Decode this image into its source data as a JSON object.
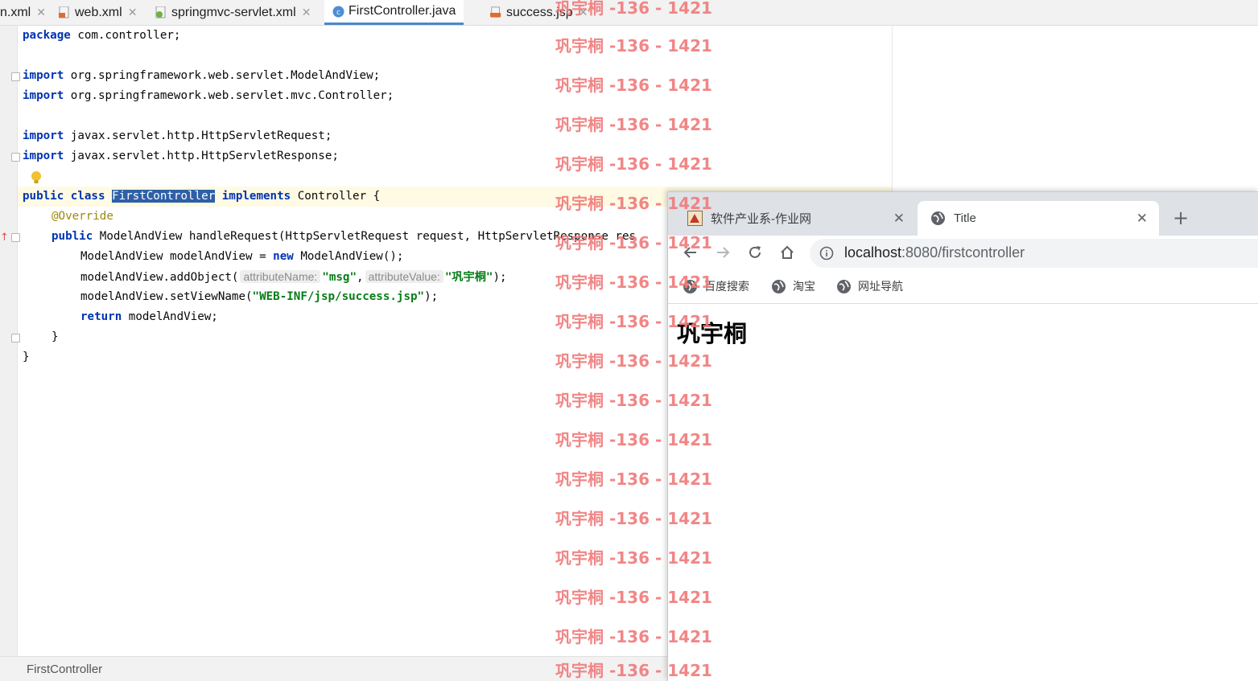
{
  "editor": {
    "tabs": [
      {
        "label": "n.xml",
        "icon": "none"
      },
      {
        "label": "web.xml",
        "icon": "xml-file-icon"
      },
      {
        "label": "springmvc-servlet.xml",
        "icon": "spring-xml-file-icon"
      },
      {
        "label": "FirstController.java",
        "icon": "java-class-icon",
        "active": true
      },
      {
        "label": "success.jsp",
        "icon": "jsp-file-icon"
      }
    ],
    "code": {
      "l1_kw": "package",
      "l1_rest": " com.controller;",
      "l3_kw": "import",
      "l3_rest": " org.springframework.web.servlet.ModelAndView;",
      "l4_kw": "import",
      "l4_rest": " org.springframework.web.servlet.mvc.Controller;",
      "l6_kw": "import",
      "l6_rest": " javax.servlet.http.HttpServletRequest;",
      "l7_kw": "import",
      "l7_rest": " javax.servlet.http.HttpServletResponse;",
      "l9_kw1": "public",
      "l9_kw2": "class",
      "l9_name": "FirstController",
      "l9_kw3": "implements",
      "l9_rest": " Controller {",
      "l10_ann": "@Override",
      "l11_kw": "public",
      "l11_rest": " ModelAndView handleRequest(HttpServletRequest request, HttpServletResponse res",
      "l12_a": "ModelAndView modelAndView = ",
      "l12_kw": "new",
      "l12_b": " ModelAndView();",
      "l13_a": "modelAndView.addObject(",
      "l13_hint1": "attributeName:",
      "l13_str1": "\"msg\"",
      "l13_comma": ",",
      "l13_hint2": "attributeValue:",
      "l13_str2": "\"巩宇桐\"",
      "l13_end": ");",
      "l14_a": "modelAndView.setViewName(",
      "l14_str": "\"WEB-INF/jsp/success.jsp\"",
      "l14_end": ");",
      "l15_kw": "return",
      "l15_rest": " modelAndView;",
      "l16": "}",
      "l17": "}"
    },
    "status": "FirstController"
  },
  "browser": {
    "tabs": [
      {
        "title": "软件产业系-作业网",
        "active": false
      },
      {
        "title": "Title",
        "active": true
      }
    ],
    "new_tab": "+",
    "url_host": "localhost",
    "url_rest": ":8080/firstcontroller",
    "bookmarks": [
      "百度搜索",
      "淘宝",
      "网址导航"
    ],
    "page_heading": "巩宇桐"
  },
  "watermark": "巩宇桐 -136 - 1421",
  "colors": {
    "keyword": "#0033b3",
    "string": "#067d17",
    "annotation": "#9e880d",
    "selection": "#2e5fa8",
    "watermark": "#f07a7a"
  }
}
